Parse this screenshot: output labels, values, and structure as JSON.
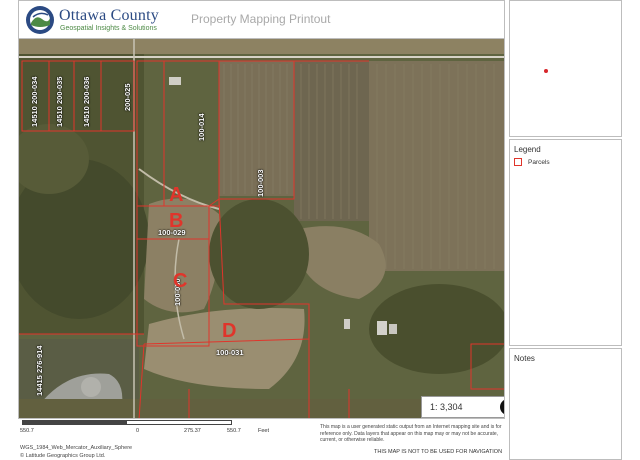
{
  "header": {
    "org_name": "Ottawa County",
    "org_tagline": "Geospatial Insights & Solutions",
    "title": "Property Mapping Printout"
  },
  "map": {
    "parcel_labels": [
      "14510 200-034",
      "14510 200-035",
      "14510 200-036",
      "200-025",
      "100-014",
      "100-003",
      "100-029",
      "100-030",
      "100-031",
      "14415 276-914"
    ],
    "annotations": [
      "A",
      "B",
      "C",
      "D"
    ],
    "scale": "1: 3,304",
    "colors": {
      "parcel_line": "#e0352b",
      "annotation": "#e0352b"
    }
  },
  "scalebar": {
    "ticks": [
      "550.7",
      "0",
      "275.37",
      "550.7"
    ],
    "unit": "Feet"
  },
  "footer": {
    "projection": "WGS_1984_Web_Mercator_Auxiliary_Sphere",
    "copyright": "© Latitude Geographics Group Ltd.",
    "disclaimer": "This map is a user generated static output from an Internet mapping site and is for reference only. Data layers that appear on this map may or may not be accurate, current, or otherwise reliable.",
    "nav_warning": "THIS MAP IS NOT TO BE USED FOR NAVIGATION"
  },
  "legend": {
    "title": "Legend",
    "items": [
      {
        "label": "Parcels",
        "color": "#e0352b"
      }
    ]
  },
  "notes": {
    "title": "Notes"
  }
}
